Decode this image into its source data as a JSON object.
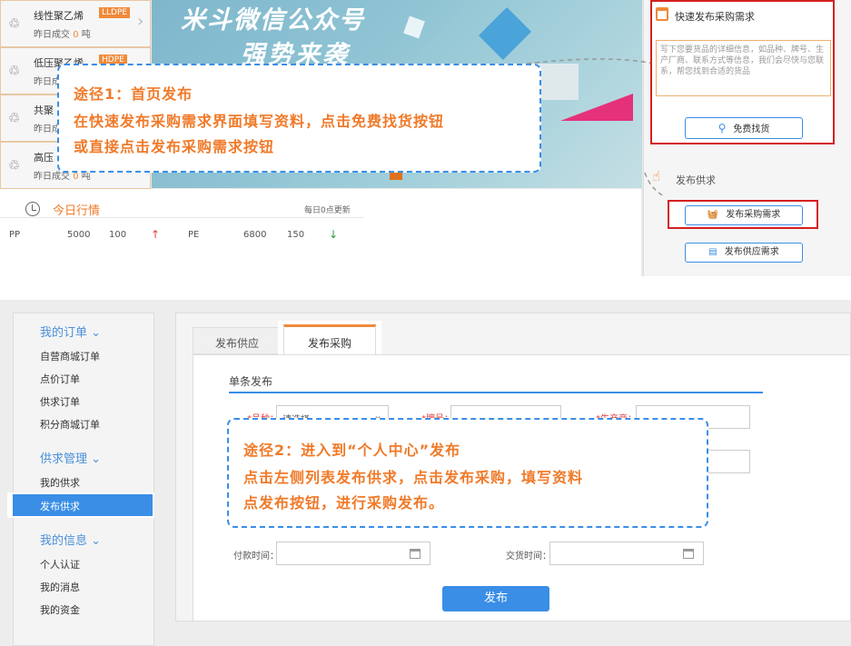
{
  "products": [
    {
      "name": "线性聚乙烯",
      "tag": "LLDPE",
      "deal_prefix": "昨日成交",
      "deal_num": "0",
      "deal_unit": "吨",
      "icon": "recycle-icon"
    },
    {
      "name": "低压聚乙烯",
      "tag": "HDPE",
      "deal_prefix": "昨日成",
      "deal_num": "",
      "deal_unit": "",
      "icon": "recycle-icon"
    },
    {
      "name": "共聚",
      "tag": "",
      "deal_prefix": "昨日成",
      "deal_num": "",
      "deal_unit": "",
      "icon": "recycle-icon"
    },
    {
      "name": "高压",
      "tag": "",
      "deal_prefix": "昨日成交",
      "deal_num": "0",
      "deal_unit": "吨",
      "icon": "recycle-icon"
    }
  ],
  "banner": {
    "line1": "米斗微信公众号",
    "line2": "强势来袭"
  },
  "tip1": {
    "line1": "途径1：首页发布",
    "line2": "在快速发布采购需求界面填写资料，点击免费找货按钮",
    "line3": "或直接点击发布采购需求按钮"
  },
  "tip2": {
    "line1": "途径2：进入到“个人中心”发布",
    "line2": "点击左侧列表发布供求，点击发布采购，填写资料",
    "line3": "点发布按钮，进行采购发布。"
  },
  "market": {
    "title": "今日行情",
    "update": "每日0点更新",
    "rows": [
      {
        "name": "PP",
        "price": "5000",
        "change": "100",
        "dir": "up"
      },
      {
        "name": "PE",
        "price": "6800",
        "change": "150",
        "dir": "down"
      }
    ],
    "up_color": "#e04040",
    "down_color": "#2a9a3a"
  },
  "quick": {
    "title": "快速发布采购需求",
    "placeholder": "写下您要货品的详细信息，如品种、牌号、生产厂商、联系方式等信息，我们会尽快与您联系，帮您找到合适的货品",
    "find_btn": "免费找货"
  },
  "publish_supply": "发布供求",
  "btn_purchase": "发布采购需求",
  "btn_supply": "发布供应需求",
  "sidebar": {
    "groups": [
      {
        "title": "我的订单",
        "items": [
          "自营商城订单",
          "点价订单",
          "供求订单",
          "积分商城订单"
        ]
      },
      {
        "title": "供求管理",
        "items": [
          "我的供求",
          "发布供求"
        ]
      },
      {
        "title": "我的信息",
        "items": [
          "个人认证",
          "我的消息",
          "我的资金"
        ]
      }
    ],
    "active": "发布供求"
  },
  "tabs": [
    "发布供应",
    "发布采购"
  ],
  "form": {
    "section": "单条发布",
    "variety_label": "*品种：",
    "variety_value": "请选择",
    "brand_label": "*牌号：",
    "maker_label": "*生产商：",
    "pay_label": "付款时间：",
    "deliver_label": "交货时间："
  },
  "submit": "发布",
  "colors": {
    "accent": "#3a8ee6",
    "orange": "#f07a29",
    "red_box": "#d42020"
  }
}
